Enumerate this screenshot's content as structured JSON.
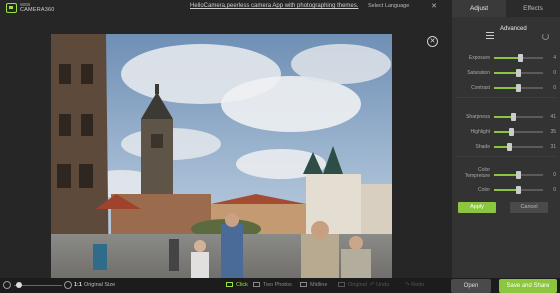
{
  "header": {
    "logo_line1": "WEB",
    "logo_line2": "CAMERA360",
    "promo_link": "HelloCamera,peerless camera App with photographing themes.",
    "language_select": "Select Language",
    "close_glyph": "✕"
  },
  "tabs": [
    {
      "label": "Adjust",
      "active": true
    },
    {
      "label": "Effects",
      "active": false
    }
  ],
  "adjust": {
    "section_title": "Advanced",
    "sliders": [
      {
        "label": "Exposure",
        "value": 4,
        "level": 0.54
      },
      {
        "label": "Saturation",
        "value": 0,
        "level": 0.5
      },
      {
        "label": "Contrast",
        "value": 0,
        "level": 0.5
      },
      {
        "label": "Sharpness",
        "value": 41,
        "level": 0.4
      },
      {
        "label": "Highlight",
        "value": 35,
        "level": 0.35
      },
      {
        "label": "Shade",
        "value": 31,
        "level": 0.31
      },
      {
        "label": "Color\nTempreture",
        "value": 0,
        "level": 0.5
      },
      {
        "label": "Color",
        "value": 0,
        "level": 0.5
      }
    ],
    "apply_label": "Apply",
    "cancel_label": "Cancel"
  },
  "photo": {
    "close_glyph": "✕"
  },
  "bottom": {
    "zoom_ratio": "1:1",
    "original_size_label": "Original Size",
    "zoom_level": 0.05,
    "modes": [
      {
        "label": "Click",
        "active": true
      },
      {
        "label": "Two Photos",
        "active": false
      },
      {
        "label": "Midline",
        "active": false
      },
      {
        "label": "Original",
        "active": false
      }
    ],
    "undo_label": "Undo",
    "redo_label": "Redo",
    "open_label": "Open",
    "save_label": "Save and Share"
  },
  "colors": {
    "accent": "#8bc63e",
    "background": "#232323",
    "panel": "#333333"
  }
}
